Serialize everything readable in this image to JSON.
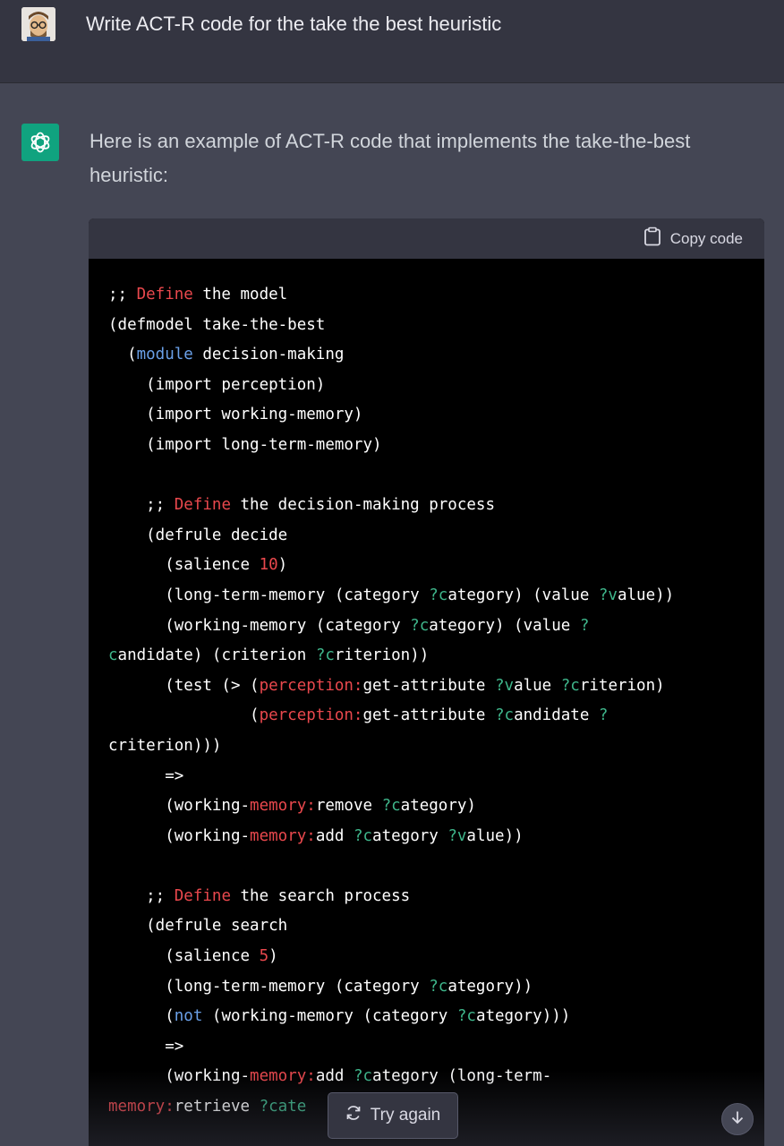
{
  "user": {
    "prompt": "Write ACT-R code for the take the best heuristic",
    "avatar_icon": "avatar-icon"
  },
  "assistant": {
    "avatar_icon": "openai-logo-icon",
    "intro_line1": "Here is an example of ACT-R code that implements the take-the-best",
    "intro_line2": "heuristic:"
  },
  "code": {
    "copy_label": "Copy code",
    "copy_icon": "clipboard-icon",
    "lines": [
      [
        [
          ";; ",
          ""
        ],
        [
          "Define",
          "red"
        ],
        [
          " the model",
          ""
        ]
      ],
      [
        [
          "(defmodel take-the-best",
          ""
        ]
      ],
      [
        [
          "  (",
          ""
        ],
        [
          "module",
          "blue"
        ],
        [
          " decision-making",
          ""
        ]
      ],
      [
        [
          "    (import perception)",
          ""
        ]
      ],
      [
        [
          "    (import working-memory)",
          ""
        ]
      ],
      [
        [
          "    (import long-term-memory)",
          ""
        ]
      ],
      [
        [
          "",
          ""
        ]
      ],
      [
        [
          "    ;; ",
          ""
        ],
        [
          "Define",
          "red"
        ],
        [
          " the decision-making process",
          ""
        ]
      ],
      [
        [
          "    (defrule decide",
          ""
        ]
      ],
      [
        [
          "      (salience ",
          ""
        ],
        [
          "10",
          "red"
        ],
        [
          ")",
          ""
        ]
      ],
      [
        [
          "      (long-term-memory (category ",
          ""
        ],
        [
          "?c",
          "green"
        ],
        [
          "ategory) (value ",
          ""
        ],
        [
          "?v",
          "green"
        ],
        [
          "alue))",
          ""
        ]
      ],
      [
        [
          "      (working-memory (category ",
          ""
        ],
        [
          "?c",
          "green"
        ],
        [
          "ategory) (value ",
          ""
        ],
        [
          "?",
          "green"
        ]
      ],
      [
        [
          "c",
          "green"
        ],
        [
          "andidate) (criterion ",
          ""
        ],
        [
          "?c",
          "green"
        ],
        [
          "riterion))",
          ""
        ]
      ],
      [
        [
          "      (test (> (",
          ""
        ],
        [
          "perception:",
          "red"
        ],
        [
          "get-attribute ",
          ""
        ],
        [
          "?v",
          "green"
        ],
        [
          "alue ",
          ""
        ],
        [
          "?c",
          "green"
        ],
        [
          "riterion)",
          ""
        ]
      ],
      [
        [
          "               (",
          ""
        ],
        [
          "perception:",
          "red"
        ],
        [
          "get-attribute ",
          ""
        ],
        [
          "?c",
          "green"
        ],
        [
          "andidate ",
          ""
        ],
        [
          "?",
          "green"
        ]
      ],
      [
        [
          "criterion)))",
          ""
        ]
      ],
      [
        [
          "      =>",
          ""
        ]
      ],
      [
        [
          "      (working-",
          ""
        ],
        [
          "memory:",
          "red"
        ],
        [
          "remove ",
          ""
        ],
        [
          "?c",
          "green"
        ],
        [
          "ategory)",
          ""
        ]
      ],
      [
        [
          "      (working-",
          ""
        ],
        [
          "memory:",
          "red"
        ],
        [
          "add ",
          ""
        ],
        [
          "?c",
          "green"
        ],
        [
          "ategory ",
          ""
        ],
        [
          "?v",
          "green"
        ],
        [
          "alue))",
          ""
        ]
      ],
      [
        [
          "",
          ""
        ]
      ],
      [
        [
          "    ;; ",
          ""
        ],
        [
          "Define",
          "red"
        ],
        [
          " the search process",
          ""
        ]
      ],
      [
        [
          "    (defrule search",
          ""
        ]
      ],
      [
        [
          "      (salience ",
          ""
        ],
        [
          "5",
          "red"
        ],
        [
          ")",
          ""
        ]
      ],
      [
        [
          "      (long-term-memory (category ",
          ""
        ],
        [
          "?c",
          "green"
        ],
        [
          "ategory))",
          ""
        ]
      ],
      [
        [
          "      (",
          ""
        ],
        [
          "not",
          "blue"
        ],
        [
          " (working-memory (category ",
          ""
        ],
        [
          "?c",
          "green"
        ],
        [
          "ategory)))",
          ""
        ]
      ],
      [
        [
          "      =>",
          ""
        ]
      ],
      [
        [
          "      (working-",
          ""
        ],
        [
          "memory:",
          "red"
        ],
        [
          "add ",
          ""
        ],
        [
          "?c",
          "green"
        ],
        [
          "ategory (long-term-",
          ""
        ]
      ],
      [
        [
          "memory:",
          "red"
        ],
        [
          "retrieve ",
          ""
        ],
        [
          "?cate",
          "green"
        ]
      ]
    ]
  },
  "controls": {
    "try_again_label": "Try again",
    "try_again_icon": "refresh-icon",
    "scroll_icon": "arrow-down-icon"
  },
  "colors": {
    "red": "#e9484d",
    "blue": "#6aa0e8",
    "green": "#3fb68b"
  }
}
